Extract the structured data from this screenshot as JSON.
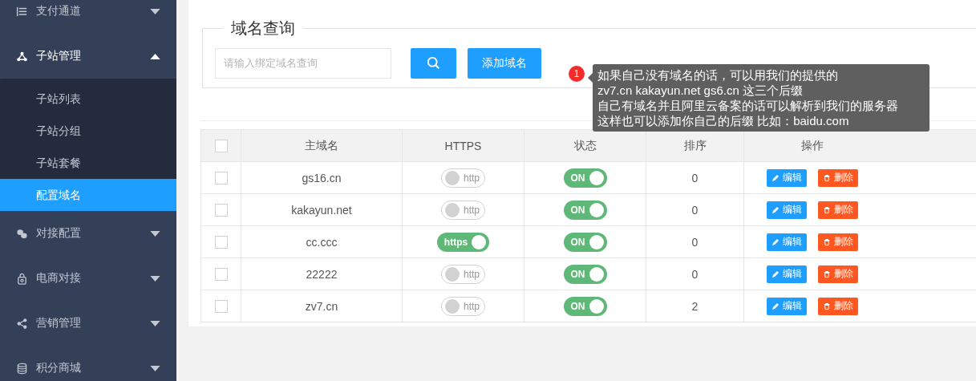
{
  "sidebar": {
    "items": [
      {
        "label": "支付通道",
        "expanded": false
      },
      {
        "label": "子站管理",
        "expanded": true,
        "children": [
          {
            "label": "子站列表",
            "selected": false
          },
          {
            "label": "子站分组",
            "selected": false
          },
          {
            "label": "子站套餐",
            "selected": false
          },
          {
            "label": "配置域名",
            "selected": true
          }
        ]
      },
      {
        "label": "对接配置",
        "expanded": false
      },
      {
        "label": "电商对接",
        "expanded": false
      },
      {
        "label": "营销管理",
        "expanded": false
      },
      {
        "label": "积分商城",
        "expanded": false
      }
    ]
  },
  "query": {
    "legend": "域名查询",
    "placeholder": "请输入绑定域名查询",
    "add_button": "添加域名"
  },
  "tip": {
    "badge": "1",
    "lines": [
      "如果自己没有域名的话，可以用我们的提供的",
      "zv7.cn kakayun.net  gs6.cn 这三个后缀",
      "自己有域名并且阿里云备案的话可以解析到我们的服务器",
      "这样也可以添加你自己的后缀  比如：baidu.com"
    ]
  },
  "table": {
    "all_checked": false,
    "columns": [
      "主域名",
      "HTTPS",
      "状态",
      "排序",
      "操作"
    ],
    "rows": [
      {
        "checked": false,
        "domain": "gs16.cn",
        "https": {
          "on": false,
          "label": "http"
        },
        "status": {
          "on": true,
          "label": "ON"
        },
        "sort": "0",
        "edit": "编辑",
        "delete": "删除"
      },
      {
        "checked": false,
        "domain": "kakayun.net",
        "https": {
          "on": false,
          "label": "http"
        },
        "status": {
          "on": true,
          "label": "ON"
        },
        "sort": "0",
        "edit": "编辑",
        "delete": "删除"
      },
      {
        "checked": false,
        "domain": "cc.ccc",
        "https": {
          "on": true,
          "label": "https"
        },
        "status": {
          "on": true,
          "label": "ON"
        },
        "sort": "0",
        "edit": "编辑",
        "delete": "删除"
      },
      {
        "checked": false,
        "domain": "22222",
        "https": {
          "on": false,
          "label": "http"
        },
        "status": {
          "on": true,
          "label": "ON"
        },
        "sort": "0",
        "edit": "编辑",
        "delete": "删除"
      },
      {
        "checked": false,
        "domain": "zv7.cn",
        "https": {
          "on": false,
          "label": "http"
        },
        "status": {
          "on": true,
          "label": "ON"
        },
        "sort": "2",
        "edit": "编辑",
        "delete": "删除"
      }
    ]
  }
}
